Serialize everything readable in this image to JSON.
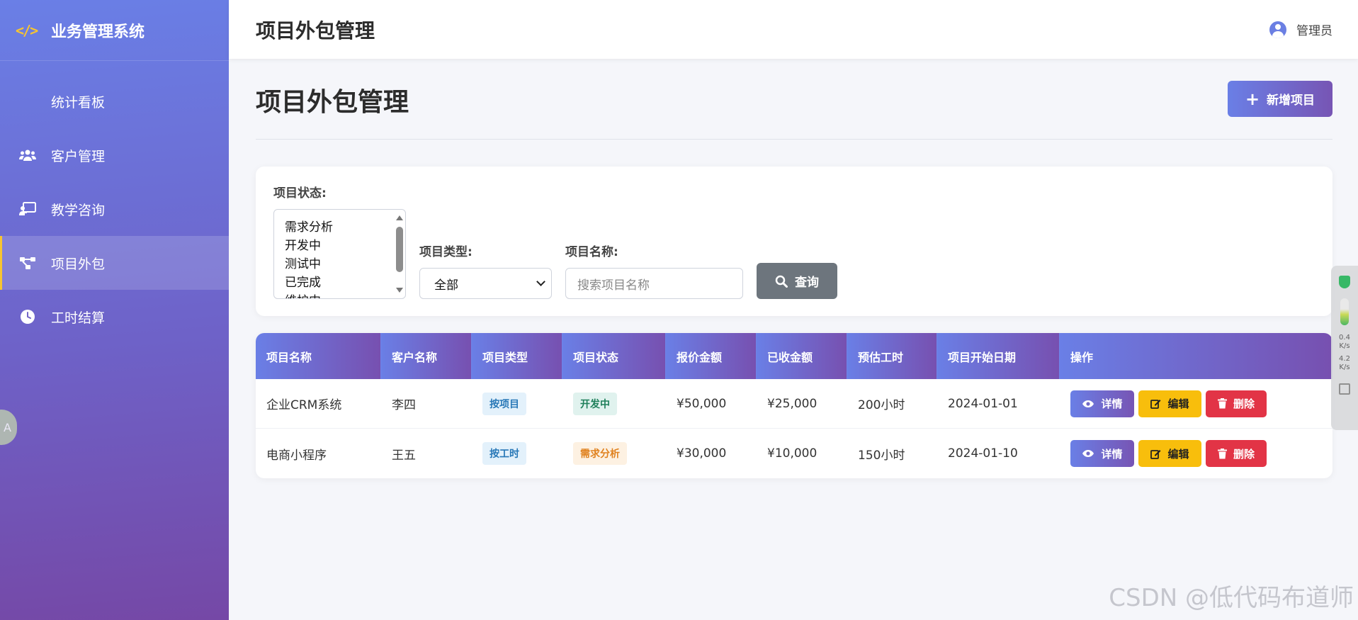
{
  "sidebar": {
    "brand": "业务管理系统",
    "logo_text": "</>",
    "items": [
      {
        "label": "统计看板",
        "icon": "none"
      },
      {
        "label": "客户管理",
        "icon": "users-icon"
      },
      {
        "label": "教学咨询",
        "icon": "chalkboard-icon"
      },
      {
        "label": "项目外包",
        "icon": "network-icon",
        "active": true
      },
      {
        "label": "工时结算",
        "icon": "clock-icon"
      }
    ],
    "translate_glyph": "A"
  },
  "header": {
    "title": "项目外包管理",
    "user": "管理员"
  },
  "main": {
    "heading": "项目外包管理",
    "new_button": "新增项目"
  },
  "filters": {
    "status_label": "项目状态:",
    "status_options": [
      "需求分析",
      "开发中",
      "测试中",
      "已完成",
      "维护中"
    ],
    "type_label": "项目类型:",
    "type_value": "全部",
    "name_label": "项目名称:",
    "name_placeholder": "搜索项目名称",
    "query_button": "查询"
  },
  "table": {
    "columns": [
      "项目名称",
      "客户名称",
      "项目类型",
      "项目状态",
      "报价金额",
      "已收金额",
      "预估工时",
      "项目开始日期",
      "操作"
    ],
    "rows": [
      {
        "name": "企业CRM系统",
        "client": "李四",
        "type": "按项目",
        "status": "开发中",
        "quote": "¥50,000",
        "received": "¥25,000",
        "hours": "200小时",
        "start": "2024-01-01"
      },
      {
        "name": "电商小程序",
        "client": "王五",
        "type": "按工时",
        "status": "需求分析",
        "quote": "¥30,000",
        "received": "¥10,000",
        "hours": "150小时",
        "start": "2024-01-10"
      }
    ],
    "actions": {
      "detail": "详情",
      "edit": "编辑",
      "delete": "删除"
    }
  },
  "widget": {
    "up_speed": "0.4",
    "down_speed": "4.2",
    "unit": "K/s"
  },
  "watermark": "CSDN @低代码布道师",
  "colors": {
    "accent": "#6a7fe6",
    "accent_dark": "#7750b0",
    "logo": "#f7c531",
    "edit": "#f8be0c",
    "delete": "#e23446",
    "query": "#6d757d"
  }
}
